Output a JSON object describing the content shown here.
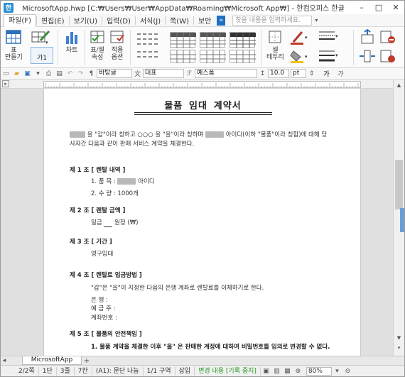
{
  "window": {
    "title": "MicrosoftApp.hwp [C:₩Users₩User₩AppData₩Roaming₩Microsoft App₩] - 한컴오피스 한글",
    "minimize": "–",
    "maximize": "□",
    "close": "✕"
  },
  "menu": {
    "items": [
      "파일(F)",
      "편집(E)",
      "보기(U)",
      "입력(D)",
      "서식(J)",
      "쪽(W)",
      "보안"
    ],
    "search_placeholder": "찾을 내용을 입력하세요."
  },
  "ribbon": {
    "make_table": "표\n만들기",
    "chart": "차트",
    "cell_props": "표/셀\n속성",
    "apply_options": "적용\n옵션",
    "style_label": "가1",
    "cell_border": "셀\n테두리"
  },
  "format_toolbar": {
    "style": "바탕글",
    "font_lang": "대표",
    "font": "예스폼",
    "size": "10.0",
    "unit": "pt",
    "char_a1": "가",
    "char_a2": "가"
  },
  "document": {
    "title": "물품 임대 계약서",
    "intro_1a": "을 \"갑\"이라 칭하고 ○○○ 을 \"을\"이라 칭하며",
    "intro_1b": "아이디(이하 \"물품\"이라 칭함)에 대해 당",
    "intro_2": "사자간 다음과 같이 판매 서비스 계약을 체결한다.",
    "art1_title": "제 1 조 [ 렌탈 내역 ]",
    "art1_item1a": "1. 품      목 :",
    "art1_item1b": "아이디",
    "art1_item2": "2. 수      량 : 1000개",
    "art2_title": "제 2 조 [ 렌탈 금액 ]",
    "art2_body_a": "일금",
    "art2_body_b": "원정  (₩)",
    "art3_title": "제 3 조 [ 기간 ]",
    "art3_body": "영구임대",
    "art4_title": "제 4 조 [ 렌탈료 입금방법 ]",
    "art4_body": "\"갑\"은 \"을\"이 지정한 다음의 은행 계좌로 렌탈료를 이체하기로 한다.",
    "art4_bank": "은       행 :",
    "art4_holder": "예  금  주 :",
    "art4_account": "계좌번호 :",
    "art5_title": "제 5 조 [ 물품의 안전책임 ]",
    "art5_body": "1. 물품 계약을 체결한 이후 \"을\" 은 판매한 계정에 대하여 비밀번호를 임의로 변경할 수 없다."
  },
  "tabs": {
    "active": "MicrosoftApp",
    "add": "+"
  },
  "status": {
    "page": "2/2쪽",
    "section": "1단",
    "line": "3줄",
    "column": "7칸",
    "paragraph": "(A1): 문단 나눔",
    "area": "1/1 구역",
    "mode": "삽입",
    "track": "변경 내용 [기록 중지]",
    "zoom": "80%"
  },
  "colors": {
    "accent": "#1e6fbf",
    "status_green": "#2a9a2a"
  }
}
